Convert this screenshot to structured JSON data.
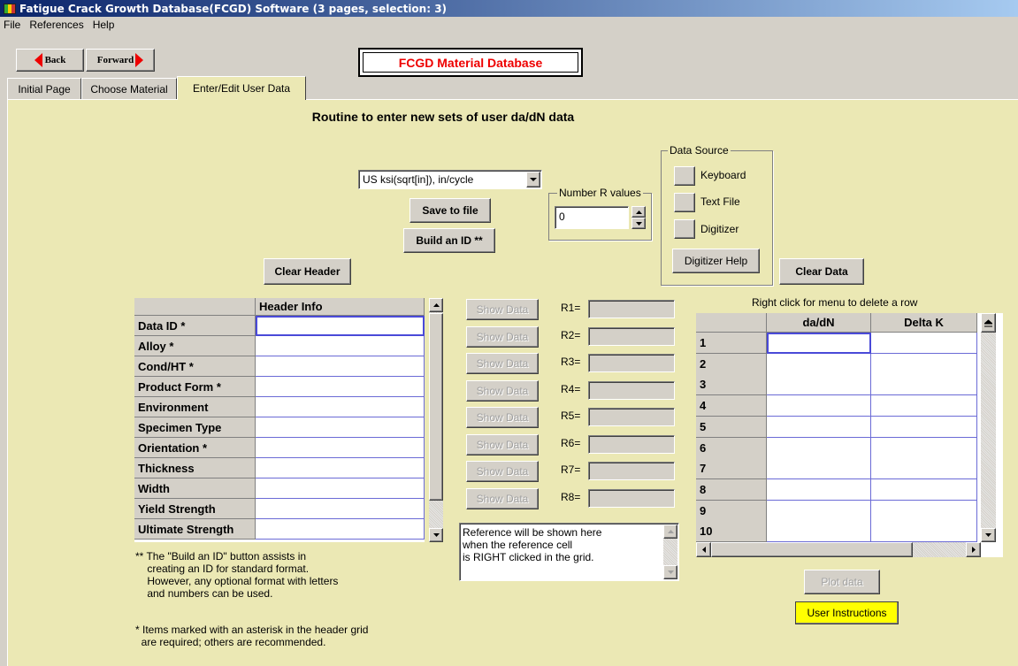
{
  "window": {
    "title": "Fatigue Crack Growth Database(FCGD) Software (3 pages, selection: 3)"
  },
  "menu": {
    "file": "File",
    "references": "References",
    "help": "Help"
  },
  "nav": {
    "back": "Back",
    "forward": "Forward"
  },
  "banner": "FCGD  Material Database",
  "tabs": [
    "Initial Page",
    "Choose Material",
    "Enter/Edit User Data"
  ],
  "heading": "Routine to enter new sets of user da/dN data",
  "units_select": {
    "value": "US ksi(sqrt[in]), in/cycle"
  },
  "buttons": {
    "save": "Save to file",
    "build_id": "Build an ID **",
    "clear_header": "Clear Header",
    "clear_data": "Clear Data",
    "plot": "Plot data",
    "instructions": "User Instructions"
  },
  "number_r": {
    "label": "Number R values",
    "value": "0"
  },
  "data_source": {
    "label": "Data Source",
    "options": [
      "Keyboard",
      "Text File",
      "Digitizer"
    ],
    "help": "Digitizer Help"
  },
  "header_grid": {
    "column": "Header Info",
    "rows": [
      "Data ID *",
      "Alloy *",
      "Cond/HT *",
      "Product Form *",
      "Environment",
      "Specimen Type",
      "Orientation *",
      "Thickness",
      "Width",
      "Yield Strength",
      "Ultimate Strength"
    ]
  },
  "r_rows": {
    "show_label": "Show Data",
    "labels": [
      "R1=",
      "R2=",
      "R3=",
      "R4=",
      "R5=",
      "R6=",
      "R7=",
      "R8="
    ]
  },
  "reference_box": "Reference will be shown here\nwhen the reference cell\nis RIGHT clicked in the grid.",
  "data_grid": {
    "hint": "Right click for menu to delete a row",
    "columns": [
      "da/dN",
      "Delta K"
    ],
    "rows": [
      "1",
      "2",
      "3",
      "4",
      "5",
      "6",
      "7",
      "8",
      "9",
      "10"
    ]
  },
  "notes": {
    "build_id": "** The \"Build an ID\" button assists in\n    creating an ID for standard format.\n    However, any optional format with letters\n    and numbers can be used.",
    "asterisk": "* Items marked with an asterisk in the header grid\n  are required; others are recommended."
  },
  "icons": {
    "back": "left-arrow-icon",
    "forward": "right-arrow-icon",
    "dropdown": "chevron-down-icon",
    "spin_up": "spin-up-icon",
    "spin_down": "spin-down-icon"
  },
  "colors": {
    "panel": "#ebe8b4",
    "banner_text": "#e00000",
    "instructions_bg": "#ffff00",
    "titlebar": "#0a246a"
  }
}
